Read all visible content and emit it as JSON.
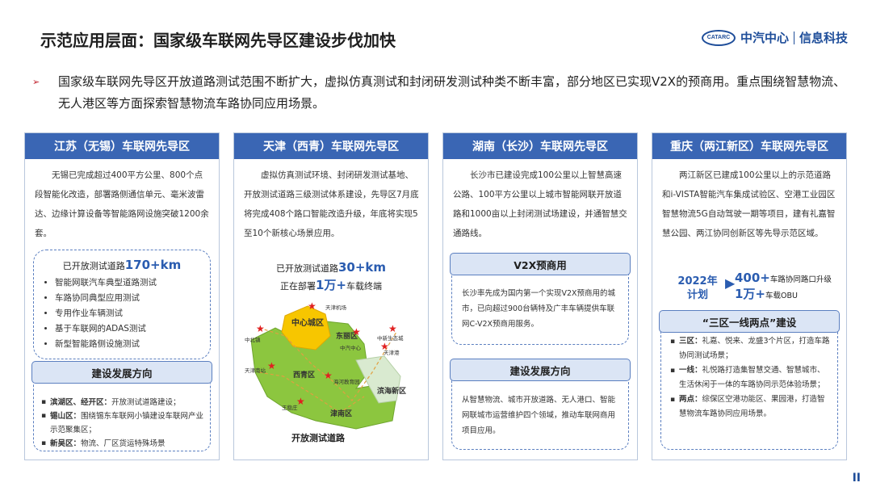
{
  "header": {
    "title": "示范应用层面：国家级车联网先导区建设步伐加快",
    "logo_mark": "CATARC",
    "logo_org": "中汽中心",
    "logo_dept": "信息科技"
  },
  "intro": {
    "arrow": "➢",
    "text": "国家级车联网先导区开放道路测试范围不断扩大，虚拟仿真测试和封闭研发测试种类不断丰富，部分地区已实现V2X的预商用。重点围绕智慧物流、无人港区等方面探索智慧物流车路协同应用场景。"
  },
  "jiangsu": {
    "title": "江苏（无锡）车联网先导区",
    "desc": "无锡已完成超过400平方公里、800个点段智能化改造，部署路侧通信单元、毫米波雷达、边缘计算设备等智能路网设施突破1200余套。",
    "stat_label": "已开放测试道路",
    "stat_value": "170+km",
    "items": [
      "智能网联汽车典型道路测试",
      "车路协同典型应用测试",
      "专用作业车辆测试",
      "基于车联网的ADAS测试",
      "新型智能路侧设施测试"
    ],
    "dir_title": "建设发展方向",
    "dirs": [
      {
        "k": "滨湖区、经开区：",
        "v": "开放测试道路建设；"
      },
      {
        "k": "锡山区：",
        "v": "围绕锡东车联网小镇建设车联网产业示范聚集区；"
      },
      {
        "k": "新吴区：",
        "v": "物流、厂区货运特殊场景"
      }
    ]
  },
  "tianjin": {
    "title": "天津（西青）车联网先导区",
    "desc": "虚拟仿真测试环境、封闭研发测试基地、开放测试道路三级测试体系建设，先导区7月底将完成408个路口智能改造升级，年底将实现5至10个新核心场景应用。",
    "stat1_label": "已开放测试道路",
    "stat1_value": "30+km",
    "stat2_pre": "正在部署",
    "stat2_value": "1万+",
    "stat2_post": "车载终端",
    "map_labels": {
      "center": "中心城区",
      "dongli": "东丽区",
      "xiqing": "西青区",
      "jinnan": "津南区",
      "binhai": "滨海新区",
      "beichen": "中北镇",
      "airport": "天津机场",
      "qiche": "中汽中心",
      "zhongxin": "中新生态城",
      "south": "天津南站",
      "port": "天津港",
      "edu": "海河教育园",
      "wangwen": "王稳庄"
    },
    "map_caption": "开放测试道路"
  },
  "hunan": {
    "title": "湖南（长沙）车联网先导区",
    "desc": "长沙市已建设完成100公里以上智慧高速公路、100平方公里以上城市智能网联开放道路和1000亩以上封闭测试场建设，并通智慧交通路线。",
    "v2x_title": "V2X预商用",
    "v2x_text": "长沙率先成为国内第一个实现V2X预商用的城市，已向超过900台辆特及广丰车辆提供车联网C-V2X预商用服务。",
    "dir_title": "建设发展方向",
    "dir_text": "从智慧物流、城市开放道路、无人港口、智能网联城市运营维护四个领域，推动车联网商用项目应用。"
  },
  "chongqing": {
    "title": "重庆（两江新区）车联网先导区",
    "desc": "两江新区已建成100公里以上的示范道路和i-VISTA智能汽车集成试验区、空港工业园区智慧物流5G自动驾驶一期等项目，建有礼嘉智慧公园、两江协同创新区等先导示范区域。",
    "plan_year": "2022年",
    "plan_word": "计划",
    "plan1_value": "400+",
    "plan1_text": "车路协同路口升级",
    "plan2_value": "1万+",
    "plan2_text": "车载OBU",
    "sub_title": "“三区一线两点”建设",
    "items": [
      {
        "k": "三区：",
        "v": "礼嘉、悦来、龙盛3个片区，打造车路协同测试场景；"
      },
      {
        "k": "一线：",
        "v": "礼悦路打造集智慧交通、智慧城市、生活休闲于一体的车路协同示范体验场景；"
      },
      {
        "k": "两点：",
        "v": "综保区空港功能区、果园港，打造智慧物流车路协同应用场景。"
      }
    ]
  },
  "footer": {
    "page_mark": "II"
  }
}
